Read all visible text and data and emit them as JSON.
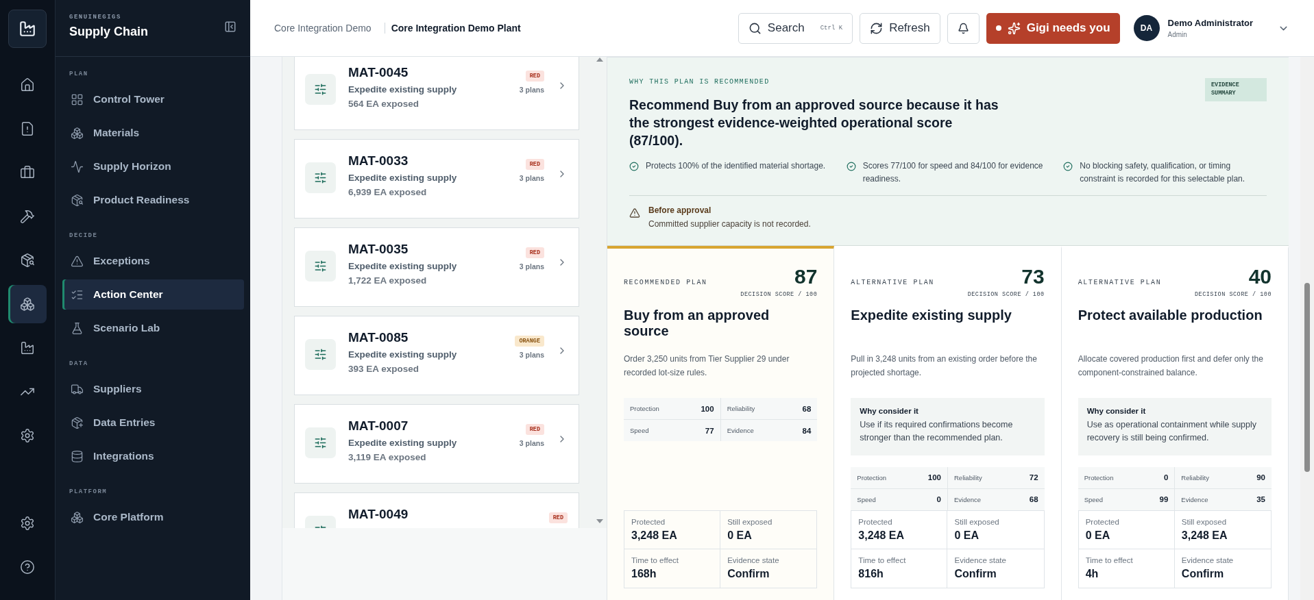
{
  "rail": {
    "items": [
      {
        "selected": false
      },
      {
        "selected": false
      },
      {
        "selected": false
      },
      {
        "selected": false
      },
      {
        "selected": false
      },
      {
        "selected": true
      },
      {
        "selected": false
      },
      {
        "selected": false
      },
      {
        "selected": false
      }
    ],
    "footer": [
      {
        "selected": false
      },
      {
        "selected": false
      }
    ]
  },
  "sidebar": {
    "brand": "GENUINEGIGS",
    "title": "Supply Chain",
    "sections": [
      {
        "heading": "PLAN",
        "items": [
          {
            "label": "Control Tower",
            "selected": false
          },
          {
            "label": "Materials",
            "selected": false
          },
          {
            "label": "Supply Horizon",
            "selected": false
          },
          {
            "label": "Product Readiness",
            "selected": false
          }
        ]
      },
      {
        "heading": "DECIDE",
        "items": [
          {
            "label": "Exceptions",
            "selected": false
          },
          {
            "label": "Action Center",
            "selected": true
          },
          {
            "label": "Scenario Lab",
            "selected": false
          }
        ]
      },
      {
        "heading": "DATA",
        "items": [
          {
            "label": "Suppliers",
            "selected": false
          },
          {
            "label": "Data Entries",
            "selected": false
          },
          {
            "label": "Integrations",
            "selected": false
          }
        ]
      },
      {
        "heading": "PLATFORM",
        "items": [
          {
            "label": "Core Platform",
            "selected": false
          }
        ]
      }
    ]
  },
  "header": {
    "breadcrumbs": [
      "Core Integration Demo",
      "Core Integration Demo Plant"
    ],
    "search": {
      "placeholder": "Search",
      "shortcut": "Ctrl K"
    },
    "refresh": "Refresh",
    "assistant": "Gigi needs you",
    "user": {
      "initials": "DA",
      "name": "Demo Administrator",
      "role": "Admin"
    }
  },
  "actions": [
    {
      "code": "MAT-0045",
      "action": "Expedite existing supply",
      "exposure": "564 EA exposed",
      "severity": "RED",
      "kind": "red",
      "plans": "3 plans"
    },
    {
      "code": "MAT-0033",
      "action": "Expedite existing supply",
      "exposure": "6,939 EA exposed",
      "severity": "RED",
      "kind": "red",
      "plans": "3 plans"
    },
    {
      "code": "MAT-0035",
      "action": "Expedite existing supply",
      "exposure": "1,722 EA exposed",
      "severity": "RED",
      "kind": "red",
      "plans": "3 plans"
    },
    {
      "code": "MAT-0085",
      "action": "Expedite existing supply",
      "exposure": "393 EA exposed",
      "severity": "ORANGE",
      "kind": "orange",
      "plans": "3 plans"
    },
    {
      "code": "MAT-0007",
      "action": "Expedite existing supply",
      "exposure": "3,119 EA exposed",
      "severity": "RED",
      "kind": "red",
      "plans": "3 plans"
    },
    {
      "code": "MAT-0049",
      "severity": "RED",
      "kind": "red"
    }
  ],
  "recommendation": {
    "eyebrow": "WHY THIS PLAN IS RECOMMENDED",
    "headline": "Recommend Buy from an approved source because it has the strongest evidence-weighted operational score (87/100).",
    "tag": "EVIDENCE SUMMARY",
    "points": [
      "Protects 100% of the identified material shortage.",
      "Scores 77/100 for speed and 84/100 for evidence readiness.",
      "No blocking safety, qualification, or timing constraint is recorded for this selectable plan."
    ],
    "caution": {
      "title": "Before approval",
      "text": "Committed supplier capacity is not recorded."
    }
  },
  "plans": [
    {
      "recommended": true,
      "label": "RECOMMENDED PLAN",
      "score": "87",
      "score_caption": "DECISION SCORE / 100",
      "title": "Buy from an approved source",
      "description": "Order 3,250 units from Tier Supplier 29 under recorded lot-size rules.",
      "scores": [
        {
          "label": "Protection",
          "value": "100"
        },
        {
          "label": "Reliability",
          "value": "68"
        },
        {
          "label": "Speed",
          "value": "77"
        },
        {
          "label": "Evidence",
          "value": "84"
        }
      ],
      "outcomes": [
        {
          "label": "Protected",
          "value": "3,248 EA"
        },
        {
          "label": "Still exposed",
          "value": "0 EA"
        },
        {
          "label": "Time to effect",
          "value": "168h"
        },
        {
          "label": "Evidence state",
          "value": "Confirm"
        }
      ]
    },
    {
      "recommended": false,
      "label": "ALTERNATIVE PLAN",
      "score": "73",
      "score_caption": "DECISION SCORE / 100",
      "title": "Expedite existing supply",
      "description": "Pull in 3,248 units from an existing order before the projected shortage.",
      "why": {
        "title": "Why consider it",
        "text": "Use if its required confirmations become stronger than the recommended plan."
      },
      "scores": [
        {
          "label": "Protection",
          "value": "100"
        },
        {
          "label": "Reliability",
          "value": "72"
        },
        {
          "label": "Speed",
          "value": "0"
        },
        {
          "label": "Evidence",
          "value": "68"
        }
      ],
      "outcomes": [
        {
          "label": "Protected",
          "value": "3,248 EA"
        },
        {
          "label": "Still exposed",
          "value": "0 EA"
        },
        {
          "label": "Time to effect",
          "value": "816h"
        },
        {
          "label": "Evidence state",
          "value": "Confirm"
        }
      ]
    },
    {
      "recommended": false,
      "label": "ALTERNATIVE PLAN",
      "score": "40",
      "score_caption": "DECISION SCORE / 100",
      "title": "Protect available production",
      "description": "Allocate covered production first and defer only the component-constrained balance.",
      "why": {
        "title": "Why consider it",
        "text": "Use as operational containment while supply recovery is still being confirmed."
      },
      "scores": [
        {
          "label": "Protection",
          "value": "0"
        },
        {
          "label": "Reliability",
          "value": "90"
        },
        {
          "label": "Speed",
          "value": "99"
        },
        {
          "label": "Evidence",
          "value": "35"
        }
      ],
      "outcomes": [
        {
          "label": "Protected",
          "value": "0 EA"
        },
        {
          "label": "Still exposed",
          "value": "3,248 EA"
        },
        {
          "label": "Time to effect",
          "value": "4h"
        },
        {
          "label": "Evidence state",
          "value": "Confirm"
        }
      ]
    }
  ]
}
